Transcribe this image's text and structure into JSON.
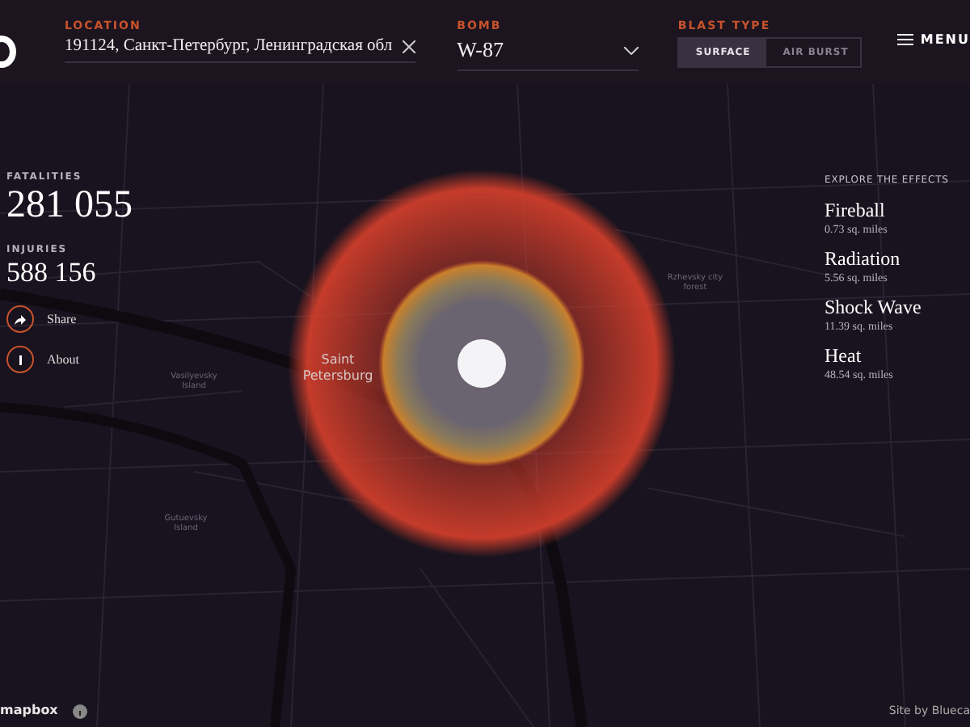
{
  "header": {
    "location": {
      "label": "LOCATION",
      "value": "191124, Санкт-Петербург, Ленинградская обл"
    },
    "bomb": {
      "label": "BOMB",
      "value": "W-87"
    },
    "blast_type": {
      "label": "BLAST TYPE",
      "options": [
        {
          "label": "SURFACE",
          "selected": true
        },
        {
          "label": "AIR BURST",
          "selected": false
        }
      ]
    },
    "menu": "MENU"
  },
  "stats": [
    {
      "label": "FATALITIES",
      "value": "281 055"
    },
    {
      "label": "INJURIES",
      "value": "588 156"
    }
  ],
  "actions": [
    {
      "label": "Share",
      "kind": "share"
    },
    {
      "label": "About",
      "kind": "about"
    }
  ],
  "effects": {
    "title": "EXPLORE THE EFFECTS",
    "items": [
      {
        "name": "Fireball",
        "area": "0.73 sq. miles"
      },
      {
        "name": "Radiation",
        "area": "5.56 sq. miles"
      },
      {
        "name": "Shock Wave",
        "area": "11.39 sq. miles"
      },
      {
        "name": "Heat",
        "area": "48.54 sq. miles"
      }
    ]
  },
  "map": {
    "labels": [
      {
        "text": "Rzhevsky city forest",
        "kind": "area"
      },
      {
        "text": "Vasilyevsky Island",
        "kind": "area"
      },
      {
        "text": "Saint Petersburg",
        "kind": "city"
      },
      {
        "text": "Gutuevsky Island",
        "kind": "area"
      }
    ]
  },
  "footer": {
    "attribution": "mapbox",
    "credit": "Site by Blueca"
  }
}
